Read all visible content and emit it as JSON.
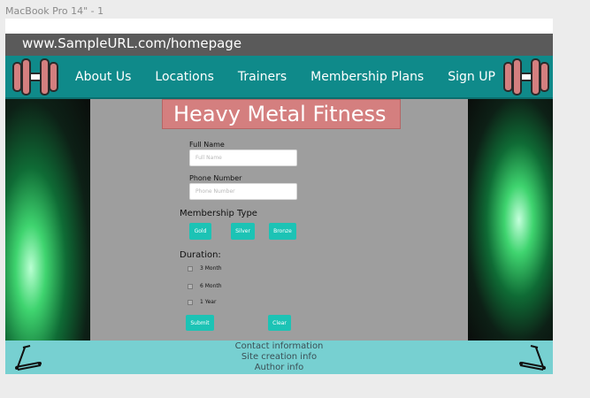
{
  "frame_label": "MacBook Pro 14\" - 1",
  "browser": {
    "url": "www.SampleURL.com/homepage"
  },
  "nav": {
    "links": [
      "About Us",
      "Locations",
      "Trainers",
      "Membership Plans",
      "Sign UP"
    ]
  },
  "icons": {
    "left_logo": "dumbbell-icon",
    "right_logo": "dumbbell-icon",
    "footer_left": "treadmill-icon",
    "footer_right": "treadmill-icon"
  },
  "form": {
    "title": "Heavy Metal Fitness",
    "full_name_label": "Full Name",
    "full_name_placeholder": "Full Name",
    "phone_label": "Phone Number",
    "phone_placeholder": "Phone Number",
    "membership_label": "Membership Type",
    "membership_options": [
      "Gold",
      "Silver",
      "Bronze"
    ],
    "duration_label": "Duration:",
    "duration_options": [
      "3 Month",
      "6 Month",
      "1 Year"
    ],
    "submit_label": "Submit",
    "clear_label": "Clear"
  },
  "footer": {
    "lines": [
      "Contact information",
      "Site creation info",
      "Author info"
    ]
  },
  "colors": {
    "nav_bg": "#0f8a8a",
    "title_bg": "#d47f7f",
    "accent_button": "#1cc3b5",
    "footer_bg": "#77d0d1",
    "panel_bg": "#9e9e9e"
  }
}
